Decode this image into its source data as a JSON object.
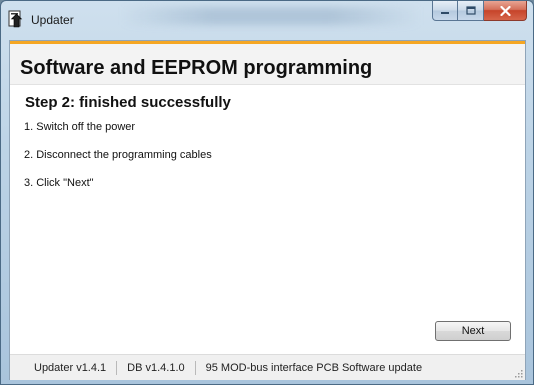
{
  "window": {
    "title": "Updater",
    "icon": "updater-app-icon"
  },
  "caption_buttons": {
    "minimize_icon": "minimize-icon",
    "maximize_icon": "maximize-icon",
    "close_icon": "close-icon"
  },
  "header": {
    "title": "Software and EEPROM programming",
    "accent_color": "#f5a623"
  },
  "step": {
    "title": "Step 2: finished successfully",
    "instructions": [
      "1. Switch off the power",
      "2. Disconnect the programming cables",
      "3. Click \"Next\""
    ]
  },
  "buttons": {
    "next_label": "Next"
  },
  "status_bar": {
    "app_version": "Updater v1.4.1",
    "db_version": "DB v1.4.1.0",
    "description": "95 MOD-bus interface PCB Software update"
  }
}
